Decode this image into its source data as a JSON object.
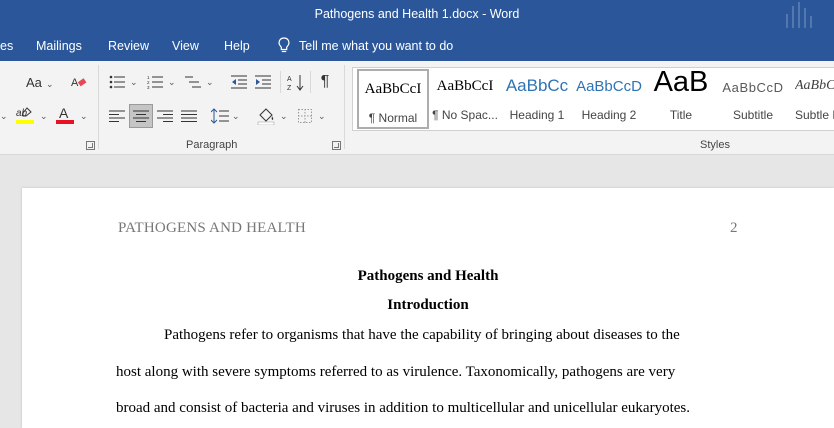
{
  "window": {
    "title": "Pathogens and Health 1.docx  -  Word"
  },
  "tabs": [
    {
      "label": "es"
    },
    {
      "label": "Mailings"
    },
    {
      "label": "Review"
    },
    {
      "label": "View"
    },
    {
      "label": "Help"
    }
  ],
  "tell_me": {
    "label": "Tell me what you want to do",
    "icon": "lightbulb-icon"
  },
  "ribbon": {
    "font_group": {
      "change_case": "Aa"
    },
    "paragraph_group": {
      "label": "Paragraph",
      "show_marks": "¶",
      "sort": "A↓Z"
    },
    "styles_group": {
      "label": "Styles",
      "items": [
        {
          "preview": "AaBbCcI",
          "name": "¶ Normal"
        },
        {
          "preview": "AaBbCcI",
          "name": "¶ No Spac..."
        },
        {
          "preview": "AaBbCc",
          "name": "Heading 1"
        },
        {
          "preview": "AaBbCcD",
          "name": "Heading 2"
        },
        {
          "preview": "AaB",
          "name": "Title"
        },
        {
          "preview": "AaBbCcD",
          "name": "Subtitle"
        },
        {
          "preview": "AaBbCcD",
          "name": "Subtle E"
        }
      ]
    },
    "colors": {
      "highlight": "#ffff00",
      "font_color": "#e81123"
    }
  },
  "document": {
    "running_head": "PATHOGENS AND HEALTH",
    "page_number": "2",
    "title": "Pathogens and Health",
    "section_heading": "Introduction",
    "lines": [
      "Pathogens refer to organisms that have the capability of bringing about diseases to the",
      "host along with severe symptoms referred to as virulence. Taxonomically, pathogens are very",
      "broad and consist of bacteria and viruses in addition to multicellular and unicellular eukaryotes."
    ]
  },
  "theme": {
    "accent": "#2b579a"
  }
}
